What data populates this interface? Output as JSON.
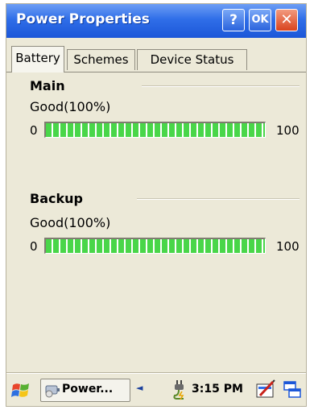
{
  "window": {
    "title": "Power Properties",
    "help_label": "?",
    "ok_label": "OK",
    "close_label": "✕"
  },
  "tabs": [
    {
      "label": "Battery",
      "active": true
    },
    {
      "label": "Schemes",
      "active": false
    },
    {
      "label": "Device Status",
      "active": false
    }
  ],
  "batteries": {
    "main": {
      "title": "Main",
      "status": "Good(100%)",
      "min_label": "0",
      "max_label": "100",
      "level_percent": 100
    },
    "backup": {
      "title": "Backup",
      "status": "Good(100%)",
      "min_label": "0",
      "max_label": "100",
      "level_percent": 100
    }
  },
  "taskbar": {
    "start_icon": "windows-flag-icon",
    "task_label": "Power...",
    "task_icon": "power-properties-icon",
    "scroll_arrow": "◄",
    "power_icon": "power-plug-icon",
    "clock": "3:15 PM",
    "sip_icon": "input-panel-icon",
    "windows_icon": "switch-windows-icon"
  },
  "colors": {
    "title_bar": "#2f6ee8",
    "window_bg": "#ece9d8",
    "bar_fill": "#49d649",
    "close_button": "#d9431e"
  }
}
